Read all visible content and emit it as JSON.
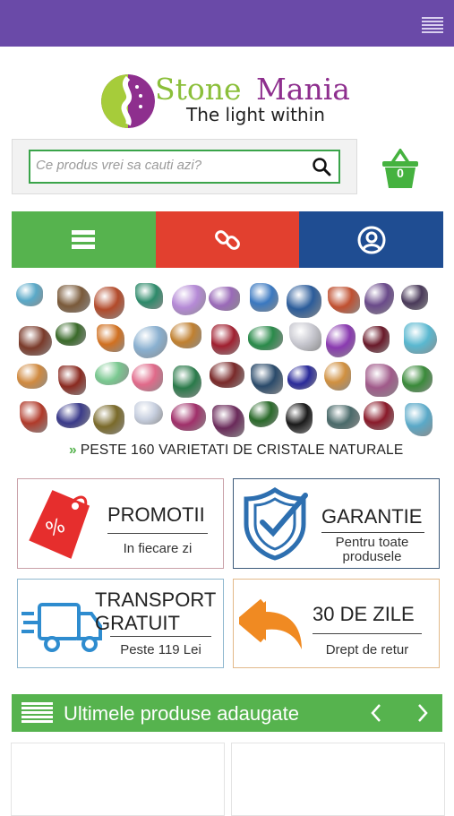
{
  "header": {
    "menu_icon": "hamburger-menu-icon"
  },
  "logo": {
    "word1": "Stone",
    "word2": "Mania",
    "tagline": "The light within"
  },
  "search": {
    "placeholder": "Ce produs vrei sa cauti azi?",
    "value": ""
  },
  "cart": {
    "count": "0"
  },
  "nav": [
    {
      "icon": "list-icon",
      "color": "#56b34e"
    },
    {
      "icon": "link-icon",
      "color": "#e2402f"
    },
    {
      "icon": "account-icon",
      "color": "#1f4d92"
    }
  ],
  "stones_caption": "PESTE 160 VARIETATI DE CRISTALE NATURALE",
  "features": [
    {
      "title": "PROMOTII",
      "subtitle": "In fiecare zi",
      "icon": "discount-tag-icon"
    },
    {
      "title": "GARANTIE",
      "subtitle": "Pentru toate produsele",
      "icon": "shield-check-icon"
    },
    {
      "title": "TRANSPORT GRATUIT",
      "subtitle": "Peste 119 Lei",
      "icon": "delivery-truck-icon"
    },
    {
      "title": "30 DE ZILE",
      "subtitle": "Drept de retur",
      "icon": "return-arrow-icon"
    }
  ],
  "latest": {
    "title": "Ultimele produse adaugate"
  },
  "colors": {
    "topbar": "#6a4aa8",
    "green": "#56b34e",
    "red": "#e2402f",
    "blue": "#1f4d92"
  }
}
